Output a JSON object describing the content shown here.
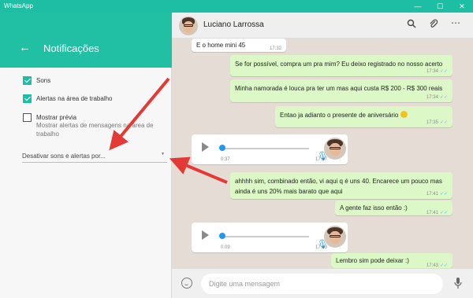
{
  "window": {
    "title": "WhatsApp",
    "controls": {
      "minimize": "—",
      "maximize": "☐",
      "close": "✕"
    },
    "accent_color": "#21c0a5"
  },
  "settings": {
    "back_icon": "arrow-left-icon",
    "title": "Notificações",
    "options": [
      {
        "label": "Sons",
        "checked": true
      },
      {
        "label": "Alertas na área de trabalho",
        "checked": true
      },
      {
        "label": "Mostrar prévia",
        "checked": false,
        "description": "Mostrar alertas de mensagens na área de trabalho"
      }
    ],
    "mute_select": {
      "label": "Desativar sons e alertas por...",
      "caret": "▼"
    }
  },
  "chat": {
    "contact_name": "Luciano Larrossa",
    "header_icons": {
      "search": "search-icon",
      "attach": "paperclip-icon",
      "menu": "more-vertical-icon"
    },
    "messages": [
      {
        "type": "text",
        "dir": "in",
        "text": "E o home mini 45",
        "time": "17:32"
      },
      {
        "type": "text",
        "dir": "out",
        "text": "Se for possível, compra um pra mim? Eu deixo registrado no nosso acerto",
        "time": "17:34"
      },
      {
        "type": "text",
        "dir": "out",
        "text": "Minha namorada é louca pra ter um mas aqui custa R$ 200 - R$ 300 reais",
        "time": "17:34"
      },
      {
        "type": "text",
        "dir": "out",
        "text": "Entao ja adianto o presente de aniversário",
        "time": "17:35"
      },
      {
        "type": "audio",
        "dir": "in",
        "duration": "0:37",
        "time": "17:37"
      },
      {
        "type": "text",
        "dir": "out",
        "text": "ahhhh sim, combinado então, vi aqui q é uns 40. Encarece um pouco mas ainda é uns 20% mais barato que aqui",
        "time": "17:41"
      },
      {
        "type": "text",
        "dir": "out",
        "text": "A gente faz isso então :)",
        "time": "17:41"
      },
      {
        "type": "audio",
        "dir": "in",
        "duration": "0:09",
        "time": "17:43"
      },
      {
        "type": "text",
        "dir": "out",
        "text": "Lembro sim pode deixar :)",
        "time": "17:43"
      }
    ],
    "read_ticks": "✓✓",
    "composer": {
      "placeholder": "Digite uma mensagem",
      "emoji_icon": "emoji-icon",
      "mic_icon": "microphone-icon"
    }
  }
}
